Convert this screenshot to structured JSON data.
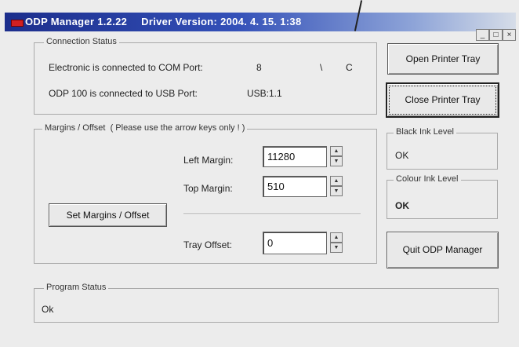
{
  "window": {
    "title": "ODP Manager 1.2.22",
    "driver": "Driver Version: 2004. 4. 15. 1:38",
    "controls": {
      "minimize": "_",
      "maximize": "□",
      "close": "×"
    }
  },
  "connection": {
    "legend": "Connection Status",
    "com_line": "Electronic is connected to COM Port:",
    "com_port": "8",
    "com_extra_a": "\\",
    "com_extra_b": "C",
    "usb_line": "ODP 100 is connected to USB Port:",
    "usb_port": "USB:1.1"
  },
  "margins": {
    "legend": "Margins / Offset",
    "note": "( Please use the arrow keys only ! )",
    "left_label": "Left Margin:",
    "left_value": "11280",
    "top_label": "Top Margin:",
    "top_value": "510",
    "set_button": "Set Margins / Offset",
    "tray_label": "Tray Offset:",
    "tray_value": "0"
  },
  "tray": {
    "open_button": "Open Printer Tray",
    "close_button": "Close Printer Tray"
  },
  "ink": {
    "black_legend": "Black Ink Level",
    "black_value": "OK",
    "colour_legend": "Colour Ink Level",
    "colour_value": "OK"
  },
  "quit_button": "Quit ODP Manager",
  "program": {
    "legend": "Program Status",
    "value": "Ok"
  }
}
